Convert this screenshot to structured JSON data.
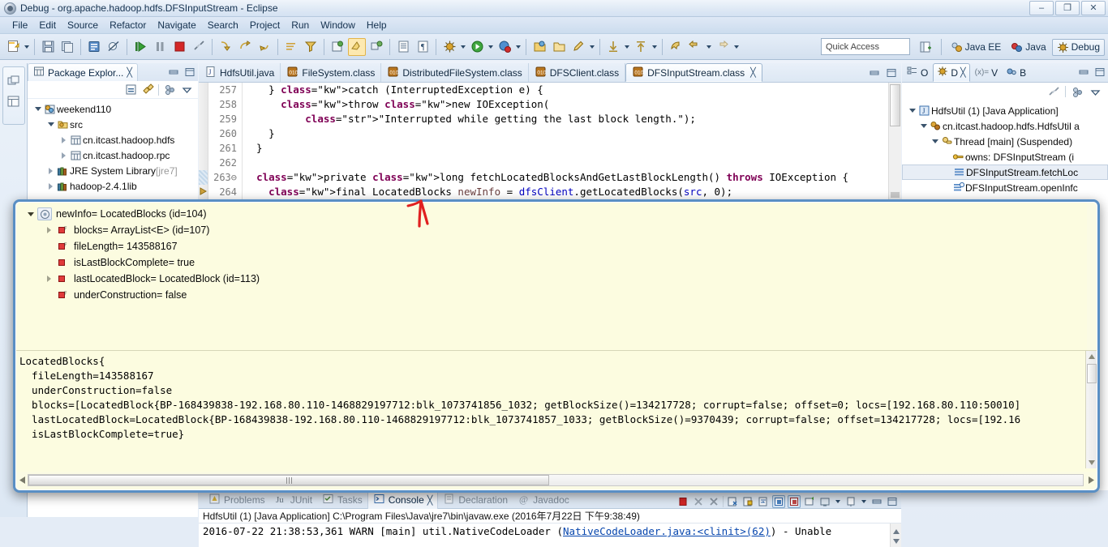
{
  "window": {
    "title": "Debug - org.apache.hadoop.hdfs.DFSInputStream - Eclipse",
    "icon": "eclipse-icon",
    "minimize": "–",
    "restore": "❐",
    "close": "✕"
  },
  "menubar": {
    "items": [
      "File",
      "Edit",
      "Source",
      "Refactor",
      "Navigate",
      "Search",
      "Project",
      "Run",
      "Window",
      "Help"
    ]
  },
  "toolbar": {
    "quick_access_placeholder": "Quick Access",
    "perspectives": [
      {
        "label": "Java EE",
        "icon": "java-ee-perspective-icon",
        "active": false
      },
      {
        "label": "Java",
        "icon": "java-perspective-icon",
        "active": false
      },
      {
        "label": "Debug",
        "icon": "debug-perspective-icon",
        "active": true
      }
    ],
    "open_perspective_icon": "open-perspective-icon"
  },
  "package_explorer": {
    "tab_label": "Package Explor...",
    "tab_icon": "package-explorer-icon",
    "close_icon": "╳",
    "minimize_icon": "minimize-icon",
    "maximize_icon": "maximize-icon",
    "tools": [
      "collapse-all-icon",
      "link-with-editor-icon",
      "view-menu-icon"
    ],
    "tree": [
      {
        "label": "weekend110",
        "icon": "java-project-icon",
        "indent": 0,
        "twisty": "open"
      },
      {
        "label": "src",
        "icon": "source-folder-icon",
        "indent": 1,
        "twisty": "open"
      },
      {
        "label": "cn.itcast.hadoop.hdfs",
        "icon": "package-icon",
        "indent": 2,
        "twisty": "closed"
      },
      {
        "label": "cn.itcast.hadoop.rpc",
        "icon": "package-icon",
        "indent": 2,
        "twisty": "closed"
      },
      {
        "label": "JRE System Library",
        "suffix": "[jre7]",
        "icon": "library-icon",
        "indent": 1,
        "twisty": "closed"
      },
      {
        "label": "hadoop-2.4.1lib",
        "icon": "library-icon",
        "indent": 1,
        "twisty": "closed"
      }
    ]
  },
  "editor": {
    "tabs": [
      {
        "label": "HdfsUtil.java",
        "icon": "java-file-icon",
        "active": false
      },
      {
        "label": "FileSystem.class",
        "icon": "class-file-icon",
        "active": false
      },
      {
        "label": "DistributedFileSystem.class",
        "icon": "class-file-icon",
        "active": false
      },
      {
        "label": "DFSClient.class",
        "icon": "class-file-icon",
        "active": false
      },
      {
        "label": "DFSInputStream.class",
        "icon": "class-file-icon",
        "active": true
      }
    ],
    "close_icon": "╳",
    "minimize_icon": "minimize-icon",
    "maximize_icon": "maximize-icon",
    "lines": [
      {
        "num": "257",
        "marker": ""
      },
      {
        "num": "258",
        "marker": ""
      },
      {
        "num": "259",
        "marker": ""
      },
      {
        "num": "260",
        "marker": ""
      },
      {
        "num": "261",
        "marker": ""
      },
      {
        "num": "262",
        "marker": ""
      },
      {
        "num": "263",
        "marker": "⊖"
      },
      {
        "num": "264",
        "marker": ""
      }
    ],
    "code": [
      "    } catch (InterruptedException e) {",
      "      throw new IOException(",
      "          \"Interrupted while getting the last block length.\");",
      "    }",
      "  }",
      "",
      "  private long fetchLocatedBlocksAndGetLastBlockLength() throws IOException {",
      "    final LocatedBlocks newInfo = dfsClient.getLocatedBlocks(src, 0);"
    ]
  },
  "debug_view": {
    "tabs": [
      {
        "label": "O",
        "icon": "outline-icon",
        "active": false
      },
      {
        "label": "D",
        "icon": "debug-icon",
        "active": true
      },
      {
        "label": "V",
        "icon": "variables-icon",
        "prefix": "(x)=",
        "active": false
      },
      {
        "label": "B",
        "icon": "breakpoints-icon",
        "active": false
      }
    ],
    "close_icon": "╳",
    "minimize_icon": "minimize-icon",
    "maximize_icon": "maximize-icon",
    "tools": [
      "disconnect-icon",
      "view-filter-icon",
      "view-menu-icon"
    ],
    "tree": [
      {
        "label": "HdfsUtil (1) [Java Application]",
        "icon": "launch-config-icon",
        "indent": 0,
        "twisty": "open"
      },
      {
        "label": "cn.itcast.hadoop.hdfs.HdfsUtil a",
        "icon": "java-process-icon",
        "indent": 1,
        "twisty": "open"
      },
      {
        "label": "Thread [main] (Suspended)",
        "icon": "thread-suspended-icon",
        "indent": 2,
        "twisty": "open"
      },
      {
        "label": "owns: DFSInputStream  (i",
        "icon": "monitor-owned-icon",
        "indent": 3,
        "twisty": "none"
      },
      {
        "label": "DFSInputStream.fetchLoc",
        "icon": "stack-frame-icon",
        "indent": 3,
        "twisty": "none",
        "selected": true
      },
      {
        "label": "DFSInputStream.openInfc",
        "icon": "stack-frame-running-icon",
        "indent": 3,
        "twisty": "none"
      }
    ]
  },
  "inspector": {
    "tree": [
      {
        "label": "newInfo= LocatedBlocks  (id=104)",
        "icon": "local-variable-icon",
        "indent": 0,
        "twisty": "open",
        "selected": true
      },
      {
        "label": "blocks= ArrayList<E>  (id=107)",
        "icon": "field-private-final-icon",
        "indent": 1,
        "twisty": "closed"
      },
      {
        "label": "fileLength= 143588167",
        "icon": "field-private-final-icon",
        "indent": 1,
        "twisty": "none"
      },
      {
        "label": "isLastBlockComplete= true",
        "icon": "field-private-icon",
        "indent": 1,
        "twisty": "none"
      },
      {
        "label": "lastLocatedBlock= LocatedBlock  (id=113)",
        "icon": "field-private-icon",
        "indent": 1,
        "twisty": "closed"
      },
      {
        "label": "underConstruction= false",
        "icon": "field-private-final-icon",
        "indent": 1,
        "twisty": "none"
      }
    ],
    "detail_lines": [
      "LocatedBlocks{",
      "  fileLength=143588167",
      "  underConstruction=false",
      "  blocks=[LocatedBlock{BP-168439838-192.168.80.110-1468829197712:blk_1073741856_1032; getBlockSize()=134217728; corrupt=false; offset=0; locs=[192.168.80.110:50010]",
      "  lastLocatedBlock=LocatedBlock{BP-168439838-192.168.80.110-1468829197712:blk_1073741857_1033; getBlockSize()=9370439; corrupt=false; offset=134217728; locs=[192.16",
      "  isLastBlockComplete=true}"
    ]
  },
  "console": {
    "tabs": [
      {
        "label": "Problems",
        "icon": "problems-icon",
        "active": false
      },
      {
        "label": "JUnit",
        "icon": "junit-icon",
        "active": false
      },
      {
        "label": "Tasks",
        "icon": "tasks-icon",
        "active": false
      },
      {
        "label": "Console",
        "icon": "console-icon",
        "active": true
      },
      {
        "label": "Declaration",
        "icon": "declaration-icon",
        "active": false
      },
      {
        "label": "Javadoc",
        "icon": "javadoc-icon",
        "active": false
      }
    ],
    "close_icon": "╳",
    "tools": [
      "terminate-icon",
      "remove-launch-icon",
      "remove-all-terminated-icon",
      "clear-console-icon",
      "scroll-lock-icon",
      "word-wrap-icon",
      "pin-console-icon",
      "display-selected-console-icon",
      "new-console-view-icon",
      "open-console-icon",
      "minimize-icon",
      "maximize-icon"
    ],
    "header": "HdfsUtil (1) [Java Application] C:\\Program Files\\Java\\jre7\\bin\\javaw.exe (2016年7月22日 下午9:38:49)",
    "line_prefix": "2016-07-22 21:38:53,361 WARN  [main] util.NativeCodeLoader (",
    "line_link": "NativeCodeLoader.java:<clinit>(62)",
    "line_suffix": ") - Unable"
  },
  "colors": {
    "accent": "#5a8fc4",
    "popup_bg": "#fcfce0",
    "keyword": "#7f0055",
    "string": "#2a00ff",
    "field": "#0000c0",
    "link": "#0645ad",
    "annotation_red": "#e02020"
  }
}
